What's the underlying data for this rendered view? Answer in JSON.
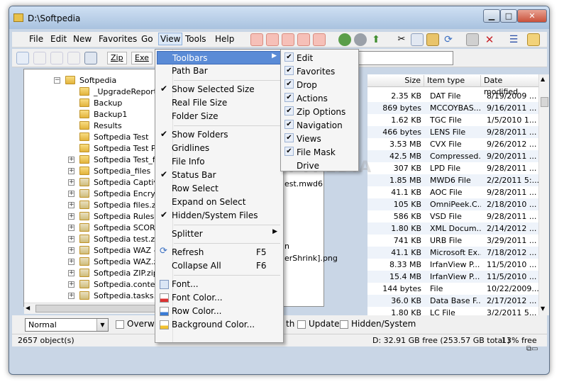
{
  "window": {
    "title": "D:\\Softpedia"
  },
  "menubar": [
    "File",
    "Edit",
    "New",
    "Favorites",
    "Go",
    "View",
    "Tools",
    "Help"
  ],
  "ext_buttons": [
    "Zip",
    "Exe"
  ],
  "tree": [
    {
      "label": "Softpedia",
      "indent": 0,
      "exp": "−",
      "type": "folder"
    },
    {
      "label": "_UpgradeReport_Fil",
      "indent": 1,
      "exp": "",
      "type": "folder"
    },
    {
      "label": "Backup",
      "indent": 1,
      "exp": "",
      "type": "folder"
    },
    {
      "label": "Backup1",
      "indent": 1,
      "exp": "",
      "type": "folder"
    },
    {
      "label": "Results",
      "indent": 1,
      "exp": "",
      "type": "folder"
    },
    {
      "label": "Softpedia Test",
      "indent": 1,
      "exp": "",
      "type": "folder"
    },
    {
      "label": "Softpedia Test Page",
      "indent": 1,
      "exp": "",
      "type": "folder"
    },
    {
      "label": "Softpedia Test_files",
      "indent": 1,
      "exp": "+",
      "type": "folder"
    },
    {
      "label": "Softpedia_files",
      "indent": 1,
      "exp": "+",
      "type": "folder"
    },
    {
      "label": "Softpedia Captivate.",
      "indent": 1,
      "exp": "+",
      "type": "zip"
    },
    {
      "label": "Softpedia Encrypted",
      "indent": 1,
      "exp": "+",
      "type": "zip"
    },
    {
      "label": "Softpedia files.zip",
      "indent": 1,
      "exp": "+",
      "type": "zip"
    },
    {
      "label": "Softpedia Rules.zip",
      "indent": 1,
      "exp": "+",
      "type": "zip"
    },
    {
      "label": "Softpedia SCORM te",
      "indent": 1,
      "exp": "+",
      "type": "zip"
    },
    {
      "label": "Softpedia test.zip",
      "indent": 1,
      "exp": "+",
      "type": "zip"
    },
    {
      "label": "Softpedia WAZ - Cop",
      "indent": 1,
      "exp": "+",
      "type": "zip"
    },
    {
      "label": "Softpedia WAZ.zip",
      "indent": 1,
      "exp": "+",
      "type": "zip"
    },
    {
      "label": "Softpedia ZIP.zip",
      "indent": 1,
      "exp": "+",
      "type": "zip"
    },
    {
      "label": "Softpedia.contexts.z",
      "indent": 1,
      "exp": "+",
      "type": "zip"
    },
    {
      "label": "Softpedia.tasks.zip",
      "indent": 1,
      "exp": "+",
      "type": "zip"
    }
  ],
  "list_partial_names": [
    "est.mwd6",
    "n",
    "erShrink].png"
  ],
  "list_headers": {
    "size": "Size",
    "type": "Item type",
    "date": "Date modified"
  },
  "list_rows": [
    {
      "size": "2.35 KB",
      "type": "DAT File",
      "date": "8/19/2009 ..."
    },
    {
      "size": "869 bytes",
      "type": "MCCOYBAS...",
      "date": "9/16/2011 ..."
    },
    {
      "size": "1.62 KB",
      "type": "TGC File",
      "date": "1/5/2010 1..."
    },
    {
      "size": "466 bytes",
      "type": "LENS File",
      "date": "9/28/2011 ..."
    },
    {
      "size": "3.53 MB",
      "type": "CVX File",
      "date": "9/26/2012 ..."
    },
    {
      "size": "42.5 MB",
      "type": "Compressed...",
      "date": "9/20/2011 ..."
    },
    {
      "size": "307 KB",
      "type": "LPD File",
      "date": "9/28/2011 ..."
    },
    {
      "size": "1.85 MB",
      "type": "MWD6 File",
      "date": "2/2/2011 5:..."
    },
    {
      "size": "41.1 KB",
      "type": "AOC File",
      "date": "9/28/2011 ..."
    },
    {
      "size": "105 KB",
      "type": "OmniPeek.C...",
      "date": "2/18/2010 ..."
    },
    {
      "size": "586 KB",
      "type": "VSD File",
      "date": "9/28/2011 ..."
    },
    {
      "size": "1.80 KB",
      "type": "XML Docum...",
      "date": "2/14/2012 ..."
    },
    {
      "size": "741 KB",
      "type": "URB File",
      "date": "3/29/2011 ..."
    },
    {
      "size": "41.1 KB",
      "type": "Microsoft Ex...",
      "date": "7/18/2012 ..."
    },
    {
      "size": "8.33 MB",
      "type": "IrfanView P...",
      "date": "11/5/2010 ..."
    },
    {
      "size": "15.4 MB",
      "type": "IrfanView P...",
      "date": "11/5/2010 ..."
    },
    {
      "size": "144 bytes",
      "type": "File",
      "date": "10/22/2009..."
    },
    {
      "size": "36.0 KB",
      "type": "Data Base F...",
      "date": "2/17/2012 ..."
    },
    {
      "size": "1.80 KB",
      "type": "LC File",
      "date": "3/2/2011 5..."
    }
  ],
  "view_menu": [
    {
      "label": "Toolbars",
      "check": false,
      "submenu": true,
      "highlight": true,
      "shortcut": ""
    },
    {
      "label": "Path Bar",
      "check": false,
      "submenu": false,
      "shortcut": ""
    },
    {
      "sep": true
    },
    {
      "label": "Show Selected Size",
      "check": true,
      "shortcut": ""
    },
    {
      "label": "Real File Size",
      "check": false,
      "shortcut": ""
    },
    {
      "label": "Folder Size",
      "check": false,
      "shortcut": ""
    },
    {
      "sep": true
    },
    {
      "label": "Show Folders",
      "check": true,
      "shortcut": ""
    },
    {
      "label": "Gridlines",
      "check": false,
      "shortcut": ""
    },
    {
      "label": "File Info",
      "check": false,
      "shortcut": ""
    },
    {
      "label": "Status Bar",
      "check": true,
      "shortcut": ""
    },
    {
      "label": "Row Select",
      "check": false,
      "shortcut": ""
    },
    {
      "label": "Expand on Select",
      "check": false,
      "shortcut": ""
    },
    {
      "label": "Hidden/System Files",
      "check": true,
      "shortcut": ""
    },
    {
      "sep": true
    },
    {
      "label": "Splitter",
      "check": false,
      "submenu": true,
      "shortcut": ""
    },
    {
      "sep": true
    },
    {
      "label": "Refresh",
      "check": false,
      "icon": "refresh-icon",
      "shortcut": "F5"
    },
    {
      "label": "Collapse All",
      "check": false,
      "shortcut": "F6"
    },
    {
      "sep": true
    },
    {
      "label": "Font...",
      "check": false,
      "icon": "font-icon",
      "shortcut": ""
    },
    {
      "label": "Font Color...",
      "check": false,
      "icon": "font-color-icon",
      "shortcut": ""
    },
    {
      "label": "Row Color...",
      "check": false,
      "icon": "row-color-icon",
      "shortcut": ""
    },
    {
      "label": "Background Color...",
      "check": false,
      "icon": "background-color-icon",
      "shortcut": ""
    }
  ],
  "toolbars_submenu": [
    "Edit",
    "Favorites",
    "Drop",
    "Actions",
    "Zip Options",
    "Navigation",
    "Views",
    "File Mask",
    "Drive"
  ],
  "toolbars_submenu_checked": [
    true,
    true,
    true,
    true,
    true,
    true,
    true,
    true,
    false
  ],
  "options": {
    "mode": "Normal",
    "overwrite_label": "Overwri",
    "path_label": "th",
    "update_label": "Update",
    "hidden_label": "Hidden/System"
  },
  "status": {
    "objects": "2657 object(s)",
    "disk": "D: 32.91 GB free (253.57 GB total )",
    "percent": "13% free"
  },
  "watermark": "SOFTPEDIA",
  "colors": {
    "menu_highlight": "#5a8bd6",
    "folder": "#e3b43c",
    "alt_row": "#eef3fa"
  }
}
